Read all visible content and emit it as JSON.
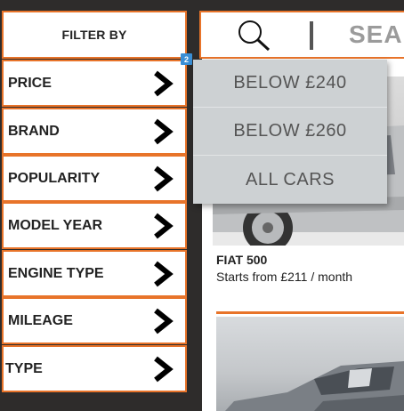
{
  "sidebar": {
    "header": "FILTER BY",
    "items": [
      {
        "label": "PRICE"
      },
      {
        "label": "BRAND"
      },
      {
        "label": "POPULARITY"
      },
      {
        "label": "MODEL YEAR"
      },
      {
        "label": "ENGINE TYPE"
      },
      {
        "label": "MILEAGE"
      },
      {
        "label": "TYPE"
      }
    ]
  },
  "search": {
    "label": "SEARCH",
    "icon": "search-icon"
  },
  "badge": "2",
  "dropdown": {
    "options": [
      "BELOW £240",
      "BELOW £260",
      "ALL CARS"
    ]
  },
  "cars": [
    {
      "name": "FIAT 500",
      "price": "Starts from £211 / month"
    }
  ],
  "colors": {
    "accent": "#e8742a",
    "background": "#2e2c2b",
    "dropdown": "#cdd1d3",
    "badge": "#3a8fd6"
  }
}
